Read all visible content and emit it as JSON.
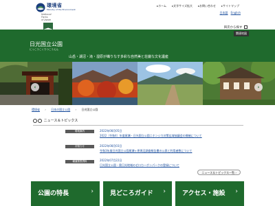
{
  "header": {
    "ministry_name": "環境省",
    "ministry_sub": "Ministry of the Environment",
    "np_logo_text": [
      "National",
      "Parks",
      "of Japan"
    ],
    "top_links": [
      "ホーム",
      "文字サイズ拡大",
      "お問い合わせ",
      "サイトマップ"
    ],
    "lang_links": [
      "日本語",
      "English"
    ],
    "toc_label": "目次から探す",
    "dark_button": "関連地図"
  },
  "park": {
    "title": "日光国立公園",
    "kana": "にっこうこくりつこうえん",
    "tagline": "山岳・湖沼・滝・湿原が織りなす多彩な自然美と荘厳な文化遺産"
  },
  "breadcrumb": {
    "items": [
      "環境省",
      "日本の国立公園",
      "日光国立公園"
    ]
  },
  "news": {
    "heading": "ニュース＆トピックス",
    "items": [
      {
        "badge": "現地案内",
        "date": "2022年08月05日",
        "title": "2022（令和4）年度尾瀬・日光国立公園ニホンジカ対策広域協議会の開催について"
      },
      {
        "badge": "お知らせ",
        "date": "2022年08月03日",
        "title": "令和3年度日光国立公園尾瀬ヶ原周辺調査報告書の公表と利用者数について"
      },
      {
        "badge": "報道発表資料",
        "date": "2022年07月22日",
        "title": "日光国立公園・奥日光地域のゼロカーボンパークの登録について"
      }
    ],
    "more_label": "ニュース＆トピックス一覧"
  },
  "cards": [
    {
      "label": "公園の特長"
    },
    {
      "label": "見どころガイド"
    },
    {
      "label": "アクセス・施設"
    }
  ],
  "colors": {
    "brand_green": "#1f6a2d",
    "link_blue": "#1a4d9c"
  }
}
